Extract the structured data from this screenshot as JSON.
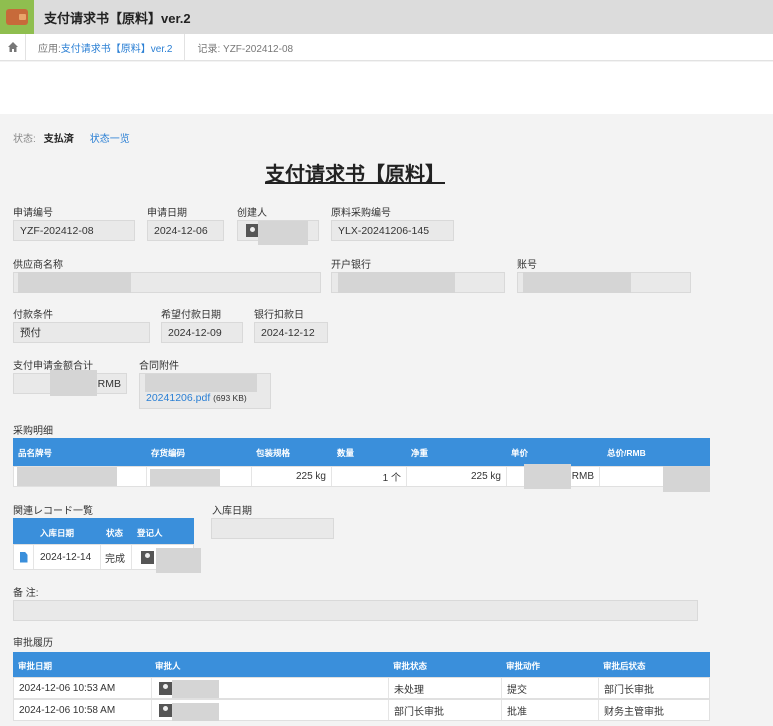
{
  "app": {
    "title": "支付请求书【原料】ver.2"
  },
  "breadcrumb": {
    "app_prefix": "应用: ",
    "app_link": "支付请求书【原料】ver.2",
    "record": "记录: YZF-202412-08"
  },
  "status": {
    "label": "状态:",
    "value": "支払済",
    "link": "状态一览"
  },
  "doc": {
    "title": "支付请求书【原料】"
  },
  "fields": {
    "request_no": {
      "label": "申请编号",
      "value": "YZF-202412-08"
    },
    "request_date": {
      "label": "申请日期",
      "value": "2024-12-06"
    },
    "creator": {
      "label": "创建人"
    },
    "purchase_no": {
      "label": "原料采购编号",
      "value": "YLX-20241206-145"
    },
    "supplier": {
      "label": "供应商名称"
    },
    "bank": {
      "label": "开户银行"
    },
    "account": {
      "label": "账号"
    },
    "payment_terms": {
      "label": "付款条件",
      "value": "预付"
    },
    "desired_date": {
      "label": "希望付款日期",
      "value": "2024-12-09"
    },
    "bank_debit_date": {
      "label": "银行扣款日",
      "value": "2024-12-12"
    },
    "total_amount": {
      "label": "支付申请金额合计",
      "unit": "RMB"
    },
    "contract": {
      "label": "合同附件",
      "file_name": "20241206.pdf",
      "file_size": "(693 KB)"
    },
    "remarks": {
      "label": "备 注:"
    }
  },
  "purchase_detail": {
    "title": "采购明细",
    "headers": [
      "品名牌号",
      "存货编码",
      "包装规格",
      "数量",
      "净重",
      "单价",
      "总价/RMB"
    ],
    "row": {
      "package": "225 kg",
      "qty": "1 个",
      "net": "225 kg",
      "unit": "RMB"
    }
  },
  "related_records": {
    "title": "関連レコード一覧",
    "headers": [
      "入库日期",
      "状态",
      "登记人"
    ],
    "row": {
      "date": "2024-12-14",
      "status": "完成"
    }
  },
  "warehouse_date": {
    "label": "入库日期"
  },
  "approval_history": {
    "title": "审批履历",
    "headers": [
      "审批日期",
      "审批人",
      "审批状态",
      "审批动作",
      "审批后状态"
    ],
    "rows": [
      {
        "date": "2024-12-06 10:53 AM",
        "status": "未处理",
        "action": "提交",
        "after": "部门长审批"
      },
      {
        "date": "2024-12-06 10:58 AM",
        "status": "部门长审批",
        "action": "批准",
        "after": "财务主管审批"
      }
    ]
  }
}
